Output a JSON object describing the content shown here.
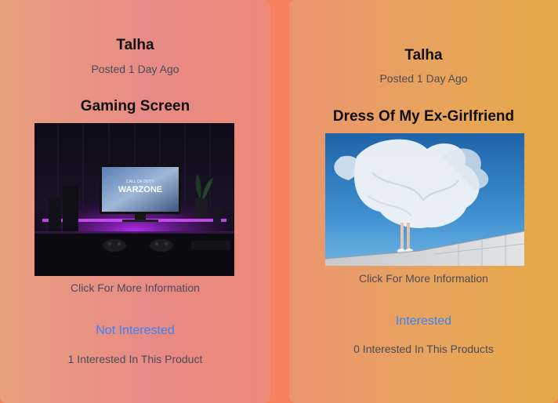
{
  "posts": [
    {
      "author": "Talha",
      "posted": "Posted 1 Day Ago",
      "title": "Gaming Screen",
      "image_alt": "Gaming setup with monitor showing WARZONE",
      "screen_title": "WARZONE",
      "screen_small": "CALL OF DUTY",
      "more_info": "Click For More Information",
      "interest_button": "Not Interested",
      "interest_count": "1 Interested In This Product",
      "accent_color": "#3b82f6"
    },
    {
      "author": "Talha",
      "posted": "Posted 1 Day Ago",
      "title": "Dress Of My Ex-Girlfriend",
      "image_alt": "White flowing dress against blue sky",
      "more_info": "Click For More Information",
      "interest_button": "Interested",
      "interest_count": "0 Interested In This Products",
      "accent_color": "#3b82f6"
    }
  ]
}
